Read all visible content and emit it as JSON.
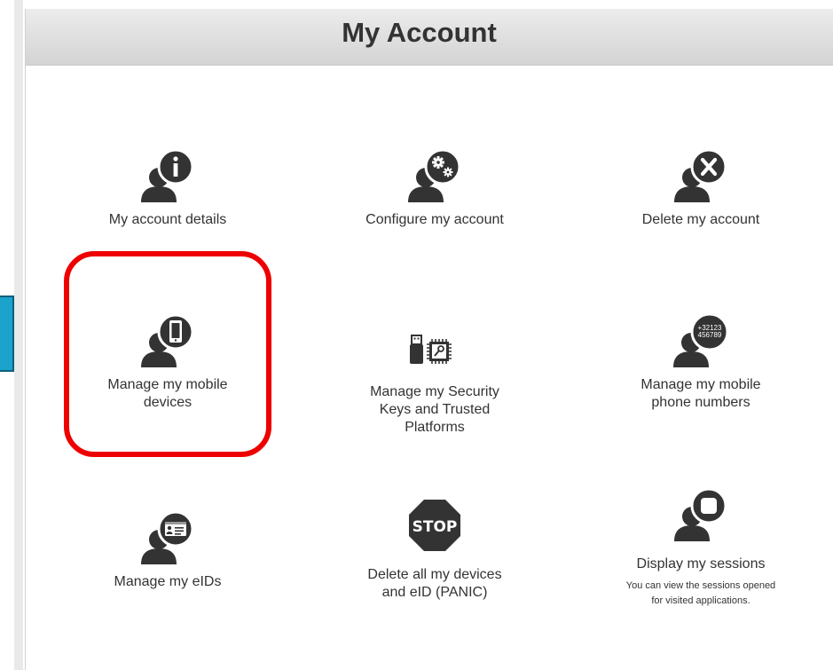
{
  "header": {
    "title": "My Account"
  },
  "tiles": [
    {
      "label": "My account details",
      "icon": "user-info-icon"
    },
    {
      "label": "Configure my account",
      "icon": "user-gears-icon"
    },
    {
      "label": "Delete my account",
      "icon": "user-delete-icon"
    },
    {
      "label": "Manage my mobile devices",
      "icon": "user-mobile-icon"
    },
    {
      "label": "Manage my Security Keys and Trusted Platforms",
      "icon": "security-key-chip-icon"
    },
    {
      "label": "Manage my mobile phone numbers",
      "icon": "user-phone-number-icon",
      "badge_line1": "+32123",
      "badge_line2": "456789"
    },
    {
      "label": "Manage my eIDs",
      "icon": "user-eid-card-icon"
    },
    {
      "label": "Delete all my devices and eID (PANIC)",
      "icon": "stop-sign-icon",
      "badge_text": "STOP"
    },
    {
      "label": "Display my sessions",
      "sub_line1": "You can view the sessions opened",
      "sub_line2": "for visited applications.",
      "icon": "user-sessions-icon"
    }
  ],
  "colors": {
    "icon": "#333333",
    "highlight": "#ee0000",
    "side_tab": "#1ba3cc"
  }
}
